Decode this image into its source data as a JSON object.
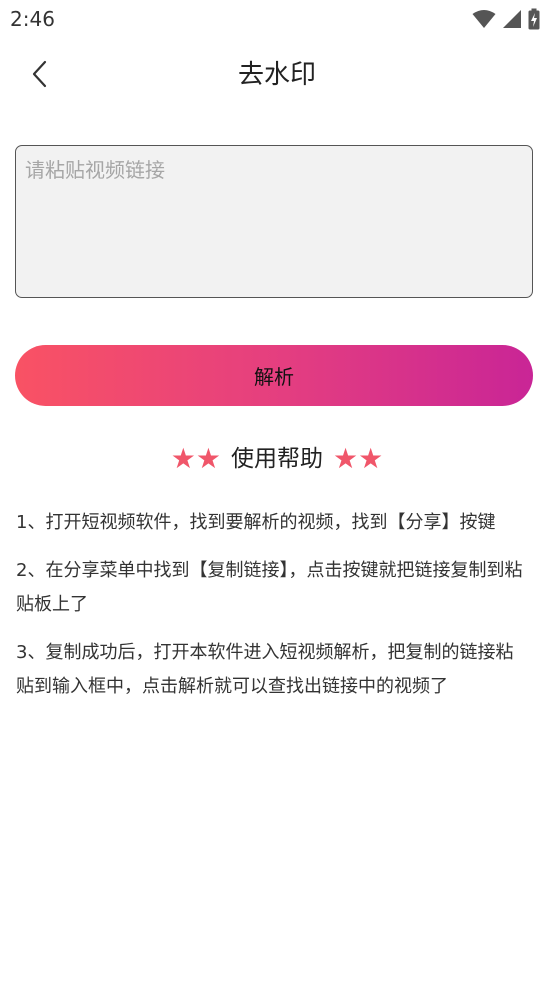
{
  "status_bar": {
    "time": "2:46",
    "icons": [
      "wifi-icon",
      "cell-signal-icon",
      "battery-charging-icon"
    ]
  },
  "header": {
    "title": "去水印",
    "back_icon": "chevron-left-icon"
  },
  "input": {
    "placeholder": "请粘贴视频链接",
    "value": ""
  },
  "parse_button": {
    "label": "解析"
  },
  "help": {
    "stars_left": "★★",
    "title": "使用帮助",
    "stars_right": "★★",
    "items": [
      "1、打开短视频软件，找到要解析的视频，找到【分享】按键",
      "2、在分享菜单中找到【复制链接】，点击按键就把链接复制到粘贴板上了",
      "3、复制成功后，打开本软件进入短视频解析，把复制的链接粘贴到输入框中，点击解析就可以查找出链接中的视频了"
    ]
  },
  "colors": {
    "accent_start": "#f95264",
    "accent_end": "#c92596",
    "star": "#f0566a"
  }
}
